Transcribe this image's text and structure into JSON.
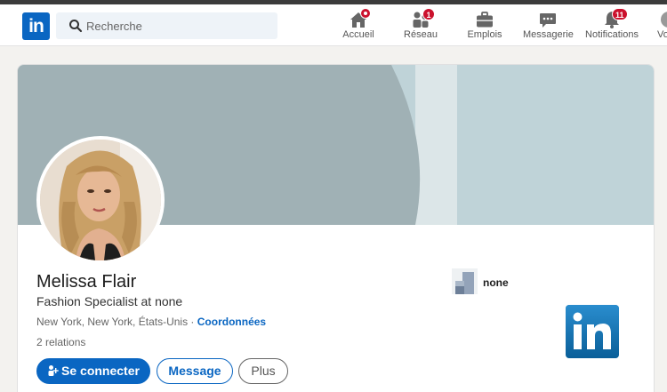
{
  "nav": {
    "logo_text": "in",
    "search_placeholder": "Recherche",
    "items": [
      {
        "label": "Accueil",
        "badge": ""
      },
      {
        "label": "Réseau",
        "badge": "1"
      },
      {
        "label": "Emplois",
        "badge": ""
      },
      {
        "label": "Messagerie",
        "badge": ""
      },
      {
        "label": "Notifications",
        "badge": "11"
      },
      {
        "label": "Vo"
      }
    ]
  },
  "profile": {
    "name": "Melissa Flair",
    "headline": "Fashion Specialist at none",
    "location": "New York, New York, États-Unis ·",
    "contact_link": "Coordonnées",
    "relations": "2 relations",
    "company": "none"
  },
  "actions": {
    "connect": "Se connecter",
    "message": "Message",
    "more": "Plus"
  },
  "colors": {
    "brand": "#0a66c2",
    "badge": "#cb112d",
    "banner": "#a0b1b5"
  }
}
